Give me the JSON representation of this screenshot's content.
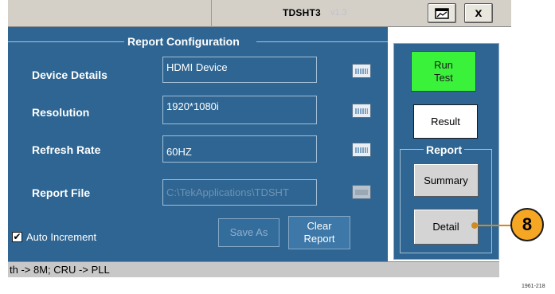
{
  "window": {
    "title": "TDSHT3",
    "version": "v1.3",
    "restore_icon": "window-icon",
    "close_label": "x"
  },
  "report_configuration": {
    "title": "Report Configuration",
    "device_details": {
      "label": "Device Details",
      "value": "HDMI Device"
    },
    "resolution": {
      "label": "Resolution",
      "value": "1920*1080i"
    },
    "refresh_rate": {
      "label": "Refresh Rate",
      "value": "60HZ"
    },
    "report_file": {
      "label": "Report File",
      "value": "C:\\TekApplications\\TDSHT"
    },
    "auto_increment": {
      "label": "Auto Increment",
      "checked": true,
      "check_glyph": "✔"
    },
    "save_as_label": "Save As",
    "clear_report_label": "Clear\nReport"
  },
  "side_panel": {
    "run_test_label": "Run\nTest",
    "result_label": "Result",
    "report_group_title": "Report",
    "summary_label": "Summary",
    "detail_label": "Detail"
  },
  "status_bar": {
    "text": "th -> 8M; CRU -> PLL"
  },
  "figure_id": "1961-218",
  "callout": {
    "number": "8"
  },
  "colors": {
    "panel_bg": "#2e6592",
    "run_button": "#3bf23b",
    "callout": "#f5a623"
  }
}
